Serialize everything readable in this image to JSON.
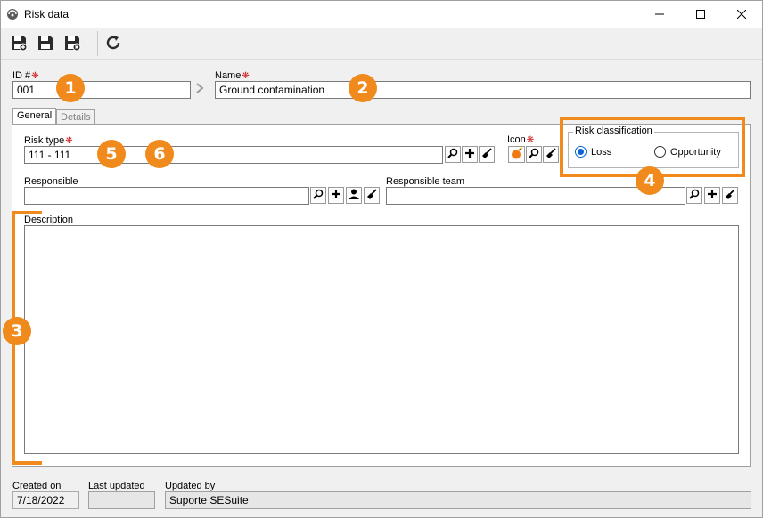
{
  "window": {
    "title": "Risk data"
  },
  "toolbar": {
    "buttons": [
      "save-new",
      "save",
      "save-close",
      "refresh"
    ]
  },
  "form": {
    "id_label": "ID #",
    "id_value": "001",
    "name_label": "Name",
    "name_value": "Ground contamination",
    "tabs": [
      {
        "label": "General",
        "active": true
      },
      {
        "label": "Details",
        "active": false
      }
    ],
    "risk_type_label": "Risk type",
    "risk_type_value": "111 - 111",
    "icon_label": "Icon",
    "risk_classification": {
      "title": "Risk classification",
      "options": [
        "Loss",
        "Opportunity"
      ],
      "selected": "Loss"
    },
    "responsible_label": "Responsible",
    "responsible_value": "",
    "responsible_team_label": "Responsible team",
    "responsible_team_value": "",
    "description_label": "Description",
    "description_value": ""
  },
  "footer": {
    "created_on_label": "Created on",
    "created_on_value": "7/18/2022",
    "last_updated_label": "Last updated",
    "last_updated_value": "",
    "updated_by_label": "Updated by",
    "updated_by_value": "Suporte SESuite"
  },
  "annotations": {
    "badges": [
      "1",
      "2",
      "3",
      "4",
      "5",
      "6"
    ],
    "color": "#f08a1c"
  },
  "colors": {
    "accent": "#0a64d4",
    "required": "#d02020",
    "highlight": "#f08a1c"
  }
}
